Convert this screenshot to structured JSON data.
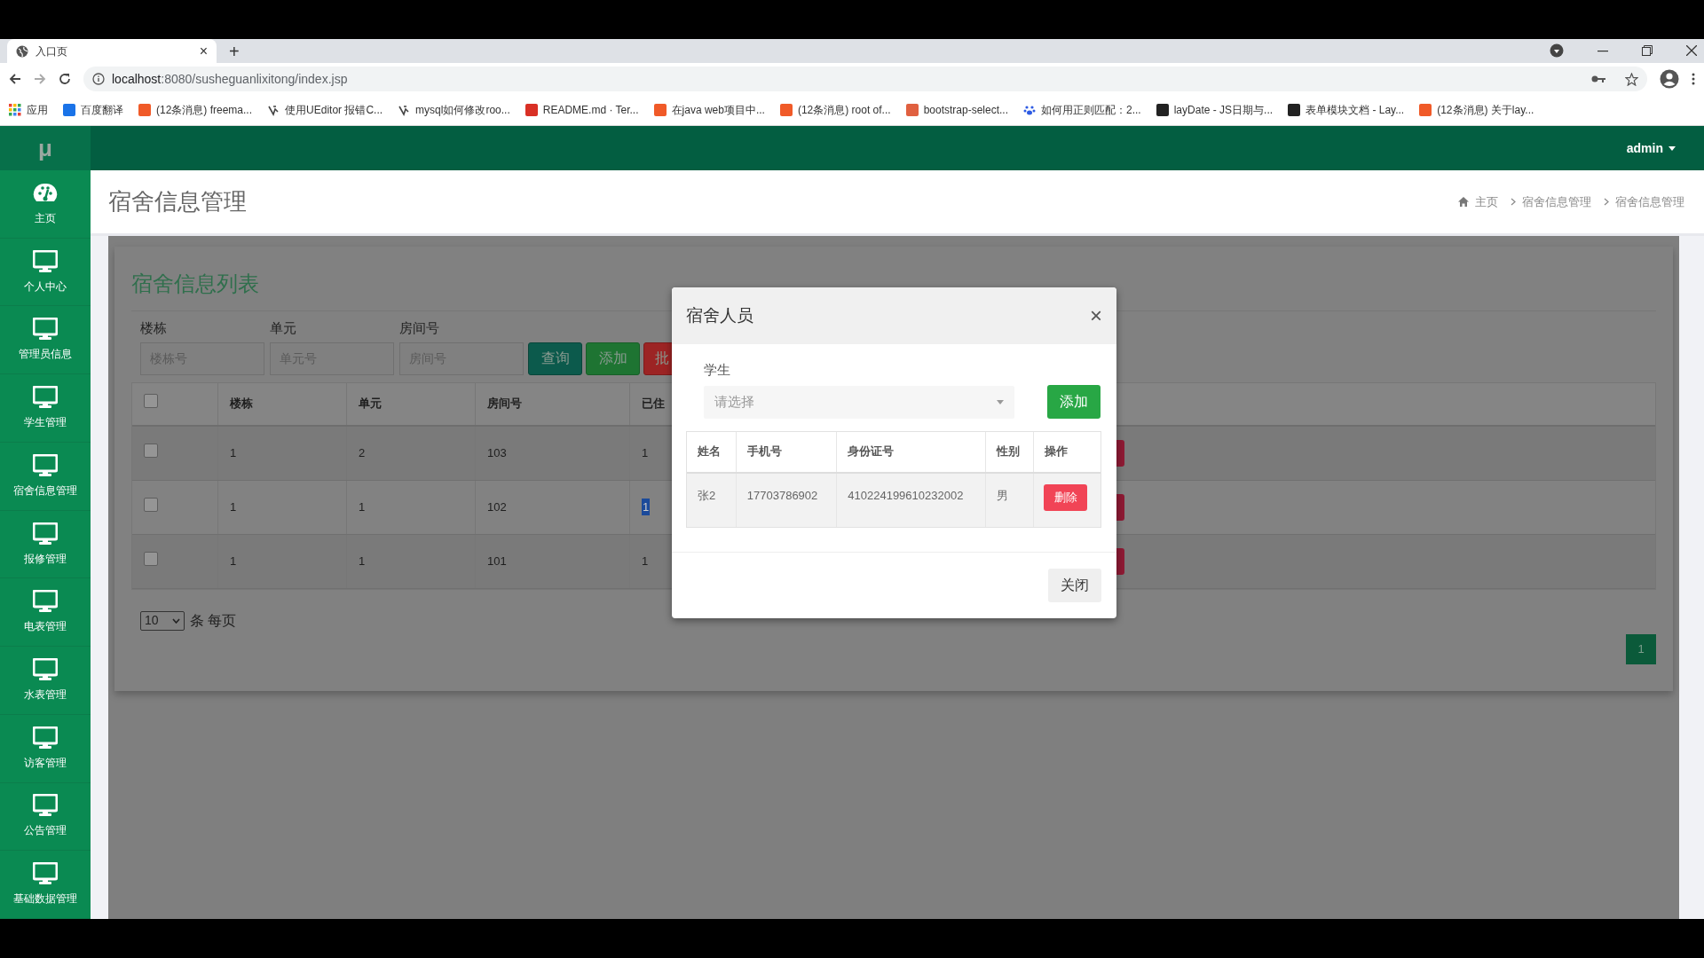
{
  "browser": {
    "tab": {
      "title": "入口页",
      "close": "×"
    },
    "new_tab": "+",
    "address": {
      "host": "localhost",
      "path": ":8080/susheguanlixitong/index.jsp"
    },
    "bookmarks": [
      "应用",
      "百度翻译",
      "(12条消息) freema...",
      "使用UEditor 报错C...",
      "mysql如何修改roo...",
      "README.md · Ter...",
      "在java web项目中...",
      "(12条消息) root of...",
      "bootstrap-select...",
      "如何用正则匹配：2...",
      "layDate - JS日期与...",
      "表单模块文档 - Lay...",
      "(12条消息) 关于lay..."
    ]
  },
  "app": {
    "logo": "μ",
    "user": "admin"
  },
  "sidebar": {
    "items": [
      "主页",
      "个人中心",
      "管理员信息",
      "学生管理",
      "宿舍信息管理",
      "报修管理",
      "电表管理",
      "水表管理",
      "访客管理",
      "公告管理",
      "基础数据管理"
    ]
  },
  "page": {
    "title": "宿舍信息管理",
    "breadcrumb": [
      "主页",
      "宿舍信息管理",
      "宿舍信息管理"
    ]
  },
  "list": {
    "title": "宿舍信息列表",
    "filters": [
      {
        "label": "楼栋",
        "placeholder": "楼栋号"
      },
      {
        "label": "单元",
        "placeholder": "单元号"
      },
      {
        "label": "房间号",
        "placeholder": "房间号"
      }
    ],
    "buttons": [
      {
        "label": "查询",
        "kind": "query"
      },
      {
        "label": "添加",
        "kind": "add"
      },
      {
        "label": "批",
        "kind": "batch"
      }
    ],
    "table": {
      "header_checked": false,
      "columns": [
        "楼栋",
        "单元",
        "房间号",
        "已住"
      ],
      "rows": [
        {
          "checked": false,
          "cells": [
            "1",
            "2",
            "103",
            "1"
          ],
          "highlighted": false
        },
        {
          "checked": false,
          "cells": [
            "1",
            "1",
            "102",
            "1"
          ],
          "highlighted": true
        },
        {
          "checked": false,
          "cells": [
            "1",
            "1",
            "101",
            "1"
          ],
          "highlighted": false
        }
      ]
    },
    "page_size": "10",
    "page_size_label": "条 每页",
    "pages": [
      {
        "label": "1",
        "selected": true
      }
    ]
  },
  "dialog": {
    "title": "宿舍人员",
    "close": "×",
    "field_label": "学生",
    "select_placeholder": "请选择",
    "add_button": "添加",
    "columns": [
      "姓名",
      "手机号",
      "身份证号",
      "性别",
      "操作"
    ],
    "rows": [
      {
        "cells": [
          "张2",
          "17703786902",
          "410224199610232002",
          "男"
        ],
        "action": "删除"
      }
    ],
    "footer_button": "关闭"
  }
}
